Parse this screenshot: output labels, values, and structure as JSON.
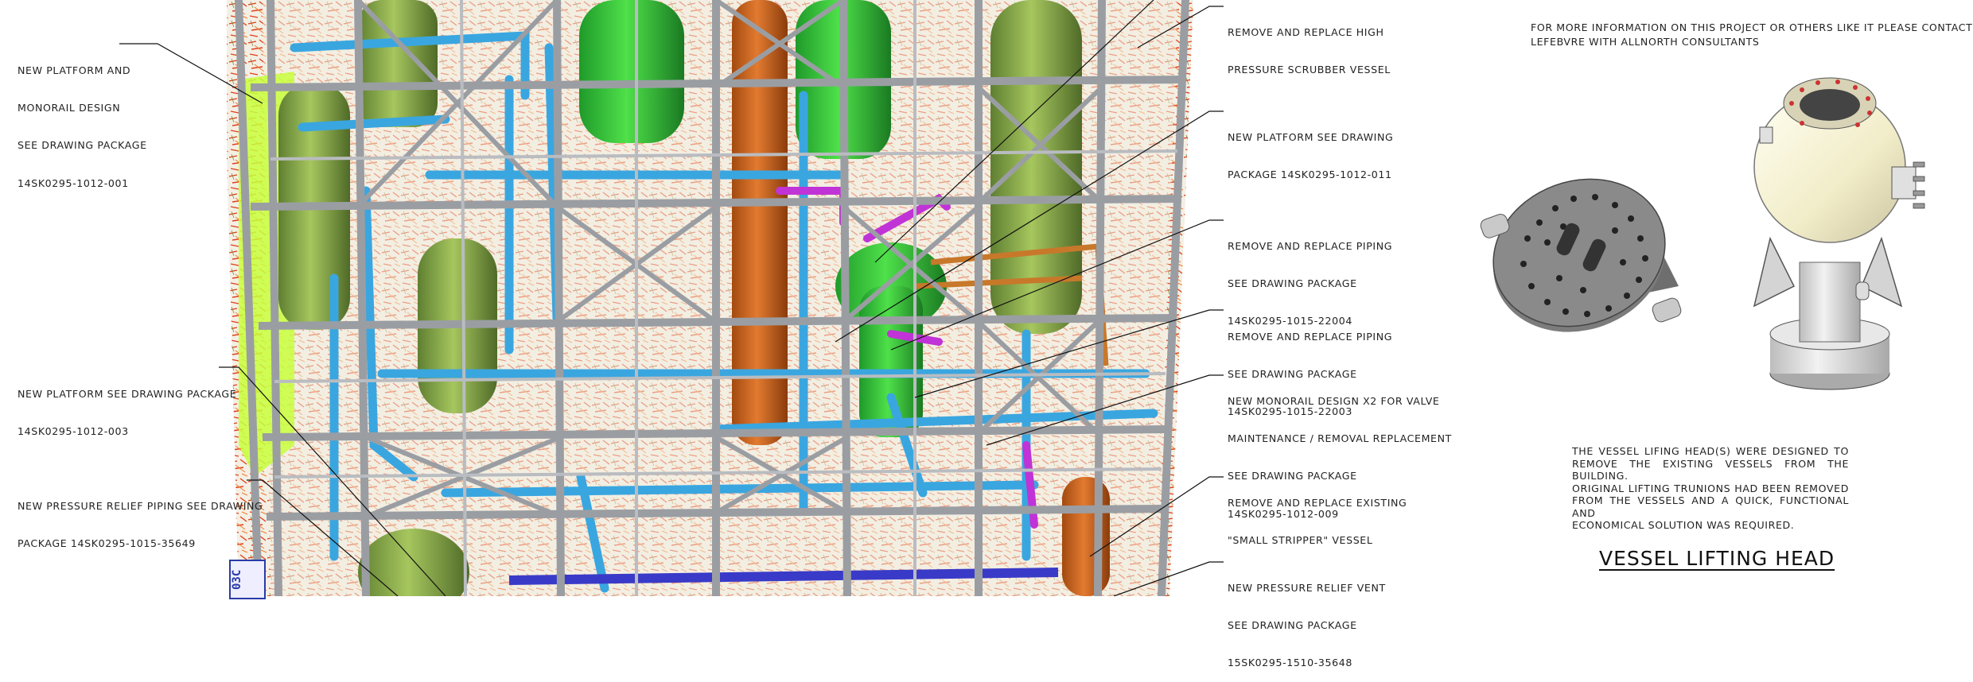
{
  "callouts_left": [
    {
      "id": "platform-monorail",
      "lines": [
        "NEW PLATFORM AND",
        "MONORAIL DESIGN",
        "SEE DRAWING PACKAGE",
        "14SK0295-1012-001"
      ]
    },
    {
      "id": "platform-003",
      "lines": [
        "NEW PLATFORM SEE DRAWING PACKAGE",
        "14SK0295-1012-003"
      ]
    },
    {
      "id": "relief-piping",
      "lines": [
        "NEW PRESSURE RELIEF PIPING SEE DRAWING",
        "PACKAGE 14SK0295-1015-35649"
      ]
    }
  ],
  "callouts_right": [
    {
      "id": "scrubber",
      "lines": [
        "REMOVE AND REPLACE HIGH",
        "PRESSURE SCRUBBER VESSEL"
      ]
    },
    {
      "id": "platform-011",
      "lines": [
        "NEW PLATFORM SEE DRAWING",
        "PACKAGE 14SK0295-1012-011"
      ]
    },
    {
      "id": "piping-22004",
      "lines": [
        "REMOVE AND REPLACE PIPING",
        "SEE DRAWING PACKAGE",
        "14SK0295-1015-22004"
      ]
    },
    {
      "id": "piping-22003",
      "lines": [
        "REMOVE AND REPLACE PIPING",
        "SEE DRAWING PACKAGE",
        "14SK0295-1015-22003"
      ]
    },
    {
      "id": "monorail-x2",
      "lines": [
        "NEW MONORAIL DESIGN x2 FOR VALVE",
        "MAINTENANCE / REMOVAL REPLACEMENT",
        "SEE DRAWING PACKAGE",
        "14SK0295-1012-009"
      ]
    },
    {
      "id": "small-stripper",
      "lines": [
        "REMOVE AND REPLACE EXISTING",
        "\"SMALL STRIPPER\" VESSEL"
      ]
    },
    {
      "id": "relief-vent",
      "lines": [
        "NEW PRESSURE RELIEF VENT",
        "SEE DRAWING PACKAGE",
        "15SK0295-1510-35648"
      ]
    }
  ],
  "info_lines": [
    "FOR MORE INFORMATION ON THIS PROJECT OR OTHERS LIKE IT PLEASE CONTACT",
    "LEFEBVRE WITH ALLNORTH CONSULTANTS"
  ],
  "description_lines": [
    "THE VESSEL LIFING HEAD(S) WERE DESIGNED TO",
    "REMOVE THE EXISTING VESSELS FROM THE BUILDING.",
    "ORIGINAL LIFTING TRUNIONS HAD BEEN REMOVED",
    "FROM THE VESSELS AND A QUICK, FUNCTIONAL AND",
    "ECONOMICAL SOLUTION WAS REQUIRED."
  ],
  "title": "VESSEL LIFTING HEAD",
  "stamp_text": "03C",
  "colors": {
    "steel": "#9a9ea3",
    "vessel_green": "#86a84a",
    "pipe_blue": "#3aa6e0",
    "vessel_orange": "#d2691e",
    "magenta": "#c033d6",
    "bright_green": "#3ed43e",
    "lime": "#c8ff3c",
    "scan_red": "#e0401a",
    "ink": "#222222"
  }
}
